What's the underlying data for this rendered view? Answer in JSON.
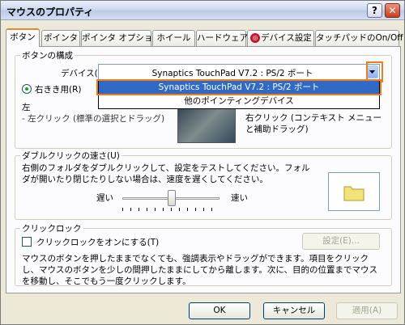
{
  "window": {
    "title": "マウスのプロパティ",
    "help_label": "?",
    "close_label": "✕"
  },
  "tabs": [
    {
      "label": "ボタン"
    },
    {
      "label": "ポインタ"
    },
    {
      "label": "ポインタ オプション"
    },
    {
      "label": "ホイール"
    },
    {
      "label": "ハードウェア"
    },
    {
      "label": "デバイス設定"
    },
    {
      "label": "タッチパッドのOn/Off"
    }
  ],
  "button_config": {
    "group_label": "ボタンの構成",
    "device_label": "デバイス(V):",
    "device_value": "Synaptics TouchPad V7.2 : PS/2 ポート",
    "device_options": [
      "Synaptics TouchPad V7.2 : PS/2 ポート",
      "他のポインティングデバイス"
    ],
    "right_handed_label": "右きき用(R)",
    "left_label": "左",
    "left_click_text": "- 左クリック (標準の選択とドラッグ)",
    "right_click_text": "右クリック (コンテキスト メニューと補助ドラッグ)"
  },
  "double_click": {
    "group_label": "ダブルクリックの速さ(U)",
    "description": "右側のフォルダをダブルクリックして、設定をテストしてください。フォルダが開いたり閉じたりしない場合は、速度を遅くしてください。",
    "slow_label": "遅い",
    "fast_label": "速い",
    "speed_level": 0.55
  },
  "click_lock": {
    "group_label": "クリックロック",
    "checkbox_label": "クリックロックをオンにする(T)",
    "settings_button": "設定(E)...",
    "description": "マウスのボタンを押したままでなくても、強調表示やドラッグができます。項目をクリックし、マウスのボタンを少しの間押したままにしてから離します。次に、目的の位置までマウスを移動し、そこでもう一度クリックします。"
  },
  "footer": {
    "ok": "OK",
    "cancel": "キャンセル",
    "apply": "適用(A)"
  }
}
